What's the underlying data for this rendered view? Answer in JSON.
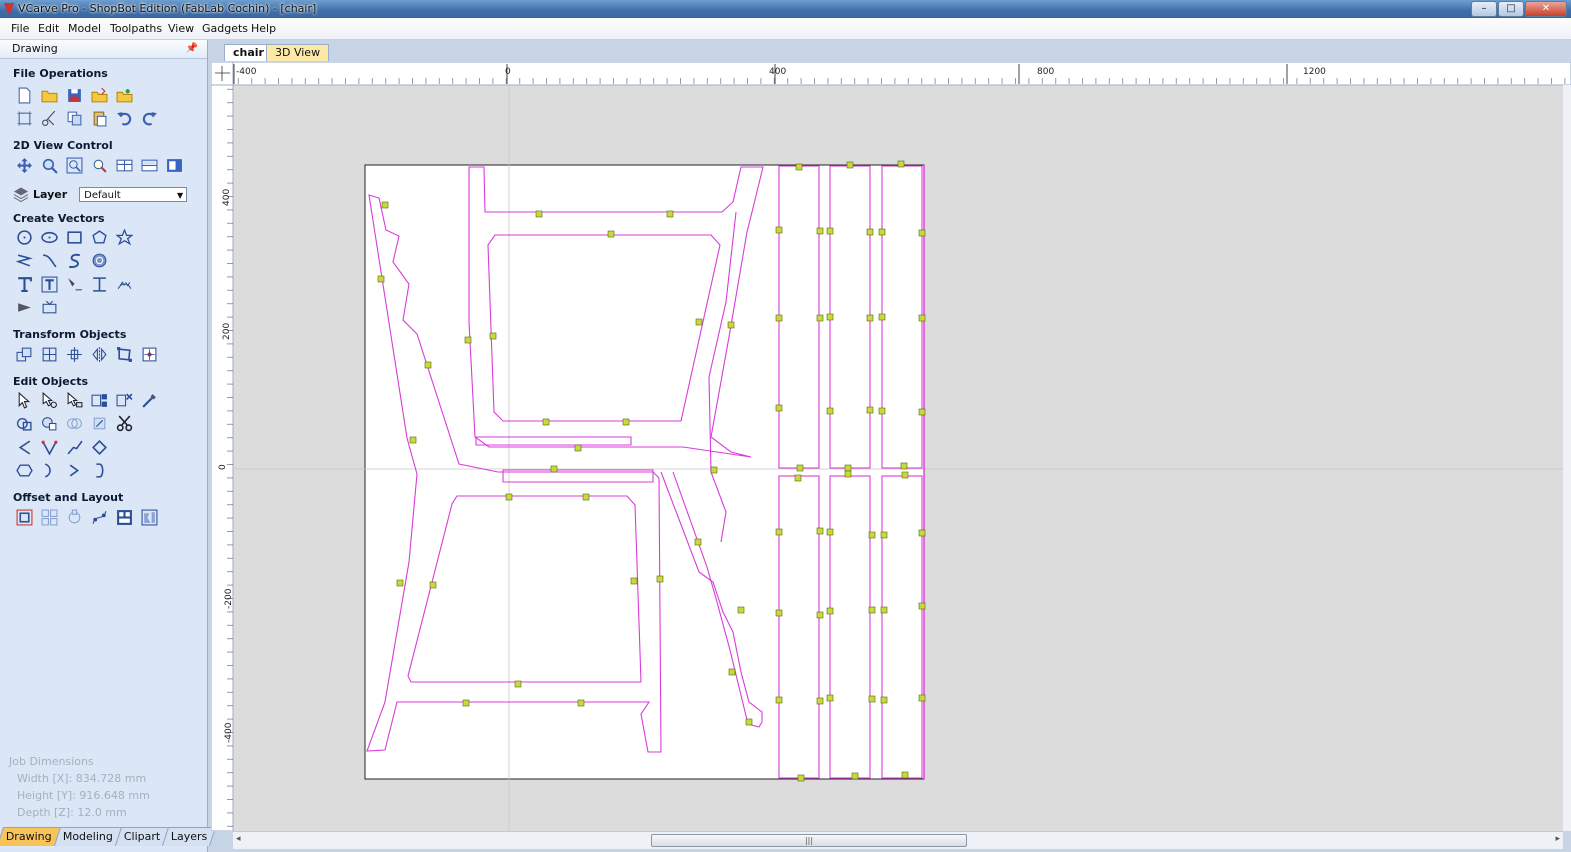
{
  "window": {
    "title": "VCarve Pro - ShopBot Edition (FabLab Cochin) - [chair]",
    "buttons": [
      "–",
      "□",
      "✕"
    ]
  },
  "menu": [
    "File",
    "Edit",
    "Model",
    "Toolpaths",
    "View",
    "Gadgets",
    "Help"
  ],
  "panel": {
    "title": "Drawing",
    "pin": "📌",
    "sections": {
      "file_ops": "File Operations",
      "view_control": "2D View Control",
      "layer_label": "Layer",
      "layer_value": "Default",
      "create_vectors": "Create Vectors",
      "transform": "Transform Objects",
      "edit": "Edit Objects",
      "offset": "Offset and Layout"
    },
    "job": {
      "heading": "Job Dimensions",
      "width": "Width  [X]: 834.728 mm",
      "height": "Height [Y]: 916.648 mm",
      "depth": "Depth  [Z]: 12.0 mm"
    },
    "tabs": [
      "Drawing",
      "Modeling",
      "Clipart",
      "Layers"
    ]
  },
  "doc_tabs": [
    "chair",
    "3D View"
  ],
  "ruler": {
    "x_labels": [
      "-400",
      "0",
      "400",
      "800",
      "1200"
    ],
    "y_labels": [
      "400",
      "200",
      "0",
      "-200",
      "-400"
    ]
  },
  "colors": {
    "vector": "#d83cd8",
    "node": "#c8d840",
    "panel": "#dbe7f6",
    "active_tab": "#f8c45a"
  }
}
